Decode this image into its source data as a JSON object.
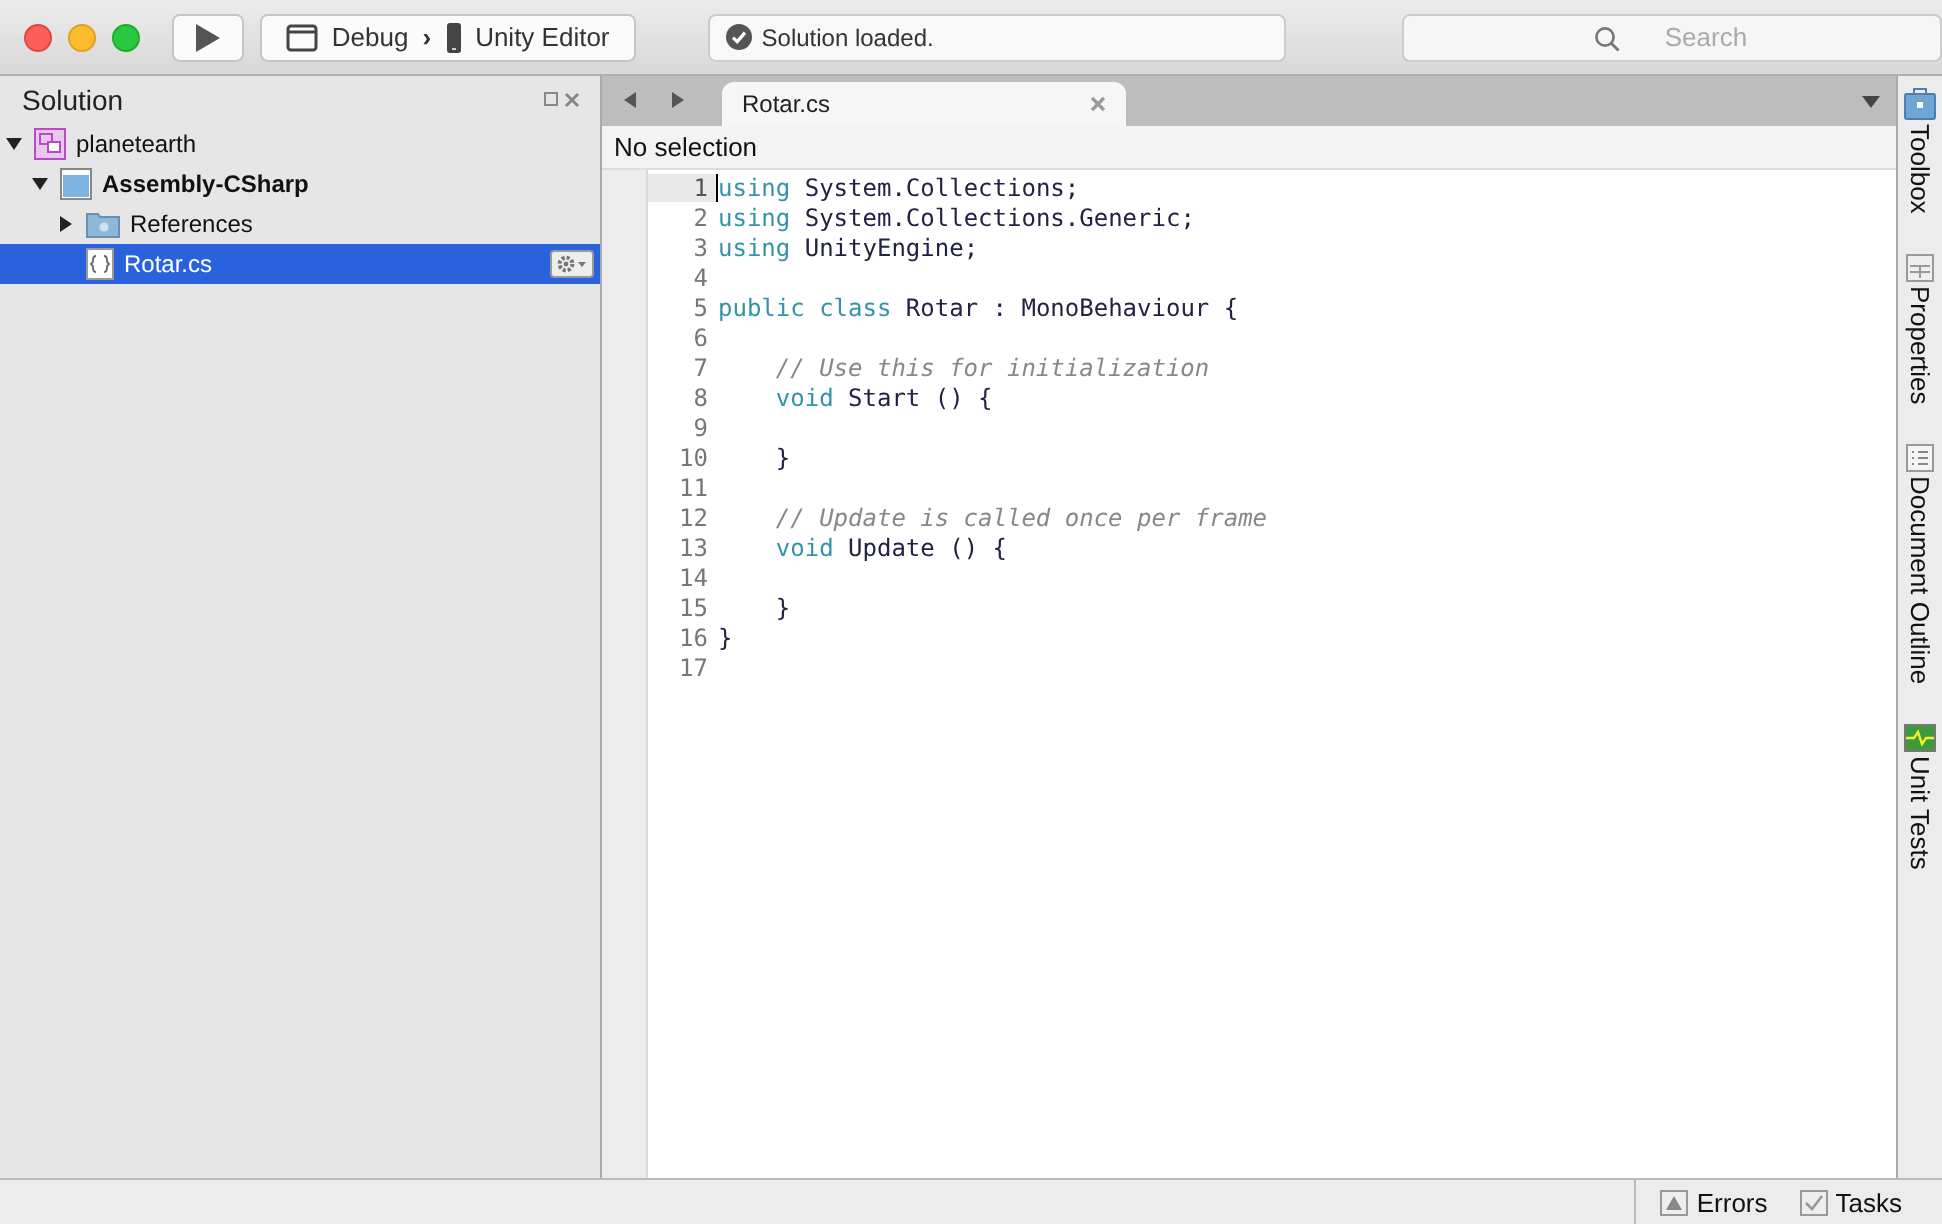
{
  "toolbar": {
    "config": "Debug",
    "separator": "›",
    "target": "Unity Editor",
    "status": "Solution loaded.",
    "search": {
      "placeholder": "Search"
    }
  },
  "solution": {
    "title": "Solution",
    "tree": [
      {
        "label": "planetearth",
        "kind": "solution",
        "expanded": true,
        "selected": false,
        "children": [
          {
            "label": "Assembly-CSharp",
            "kind": "project",
            "expanded": true,
            "selected": false,
            "children": [
              {
                "label": "References",
                "kind": "references",
                "expanded": false,
                "selected": false
              },
              {
                "label": "Rotar.cs",
                "kind": "file",
                "selected": true
              }
            ]
          }
        ]
      }
    ]
  },
  "editor": {
    "tabs": [
      {
        "label": "Rotar.cs",
        "selected": true
      }
    ],
    "breadcrumb": "No selection",
    "lines": [
      {
        "number": "1",
        "current": true,
        "indented": false,
        "segments": [
          {
            "kind": "keyword",
            "text": "using"
          },
          {
            "kind": "plain",
            "text": " System.Collections;"
          }
        ]
      },
      {
        "number": "2",
        "current": false,
        "indented": false,
        "segments": [
          {
            "kind": "keyword",
            "text": "using"
          },
          {
            "kind": "plain",
            "text": " System.Collections.Generic;"
          }
        ]
      },
      {
        "number": "3",
        "current": false,
        "indented": false,
        "segments": [
          {
            "kind": "keyword",
            "text": "using"
          },
          {
            "kind": "plain",
            "text": " UnityEngine;"
          }
        ]
      },
      {
        "number": "4",
        "current": false
      },
      {
        "number": "5",
        "current": false,
        "indented": false,
        "segments": [
          {
            "kind": "keyword",
            "text": "public class"
          },
          {
            "kind": "plain",
            "text": " Rotar : MonoBehaviour {"
          }
        ]
      },
      {
        "number": "6",
        "current": false
      },
      {
        "number": "7",
        "current": false,
        "indented": true,
        "segments": [
          {
            "kind": "comment",
            "text": "// Use this for initialization"
          }
        ]
      },
      {
        "number": "8",
        "current": false,
        "indented": true,
        "segments": [
          {
            "kind": "keyword",
            "text": "void"
          },
          {
            "kind": "plain",
            "text": " Start () {"
          }
        ]
      },
      {
        "number": "9",
        "current": false
      },
      {
        "number": "10",
        "current": false,
        "indented": true,
        "segments": [
          {
            "kind": "plain",
            "text": "}"
          }
        ]
      },
      {
        "number": "11",
        "current": false
      },
      {
        "number": "12",
        "current": false,
        "indented": true,
        "segments": [
          {
            "kind": "comment",
            "text": "// Update is called once per frame"
          }
        ]
      },
      {
        "number": "13",
        "current": false,
        "indented": true,
        "segments": [
          {
            "kind": "keyword",
            "text": "void"
          },
          {
            "kind": "plain",
            "text": " Update () {"
          }
        ]
      },
      {
        "number": "14",
        "current": false
      },
      {
        "number": "15",
        "current": false,
        "indented": true,
        "segments": [
          {
            "kind": "plain",
            "text": "}"
          }
        ]
      },
      {
        "number": "16",
        "current": false,
        "indented": false,
        "segments": [
          {
            "kind": "plain",
            "text": "}"
          }
        ]
      },
      {
        "number": "17",
        "current": false
      }
    ]
  },
  "side_pads": [
    {
      "label": "Toolbox",
      "kind": "toolbox"
    },
    {
      "label": "Properties",
      "kind": "properties"
    },
    {
      "label": "Document Outline",
      "kind": "outline"
    },
    {
      "label": "Unit Tests",
      "kind": "tests"
    }
  ],
  "status_bar": [
    {
      "label": "Errors",
      "kind": "errors"
    },
    {
      "label": "Tasks",
      "kind": "tasks"
    }
  ]
}
